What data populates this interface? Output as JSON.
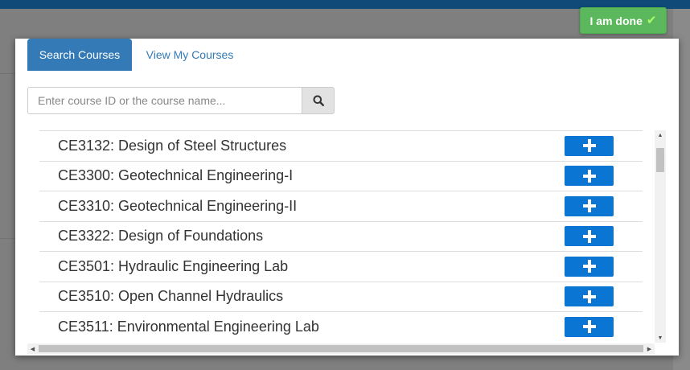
{
  "done_button": {
    "label": "I am done",
    "check": "✔"
  },
  "tabs": [
    {
      "label": "Search Courses",
      "active": true
    },
    {
      "label": "View My Courses",
      "active": false
    }
  ],
  "search": {
    "value": "",
    "placeholder": "Enter course ID or the course name...",
    "icon": "search-icon"
  },
  "courses": [
    {
      "label": "CE3132: Design of Steel Structures"
    },
    {
      "label": "CE3300: Geotechnical Engineering-I"
    },
    {
      "label": "CE3310: Geotechnical Engineering-II"
    },
    {
      "label": "CE3322: Design of Foundations"
    },
    {
      "label": "CE3501: Hydraulic Engineering Lab"
    },
    {
      "label": "CE3510: Open Channel Hydraulics"
    },
    {
      "label": "CE3511: Environmental Engineering Lab"
    }
  ],
  "colors": {
    "primary": "#337ab7",
    "add_button": "#0b75d3",
    "done_button": "#5cb85c",
    "top_bar": "#0f4a78"
  }
}
